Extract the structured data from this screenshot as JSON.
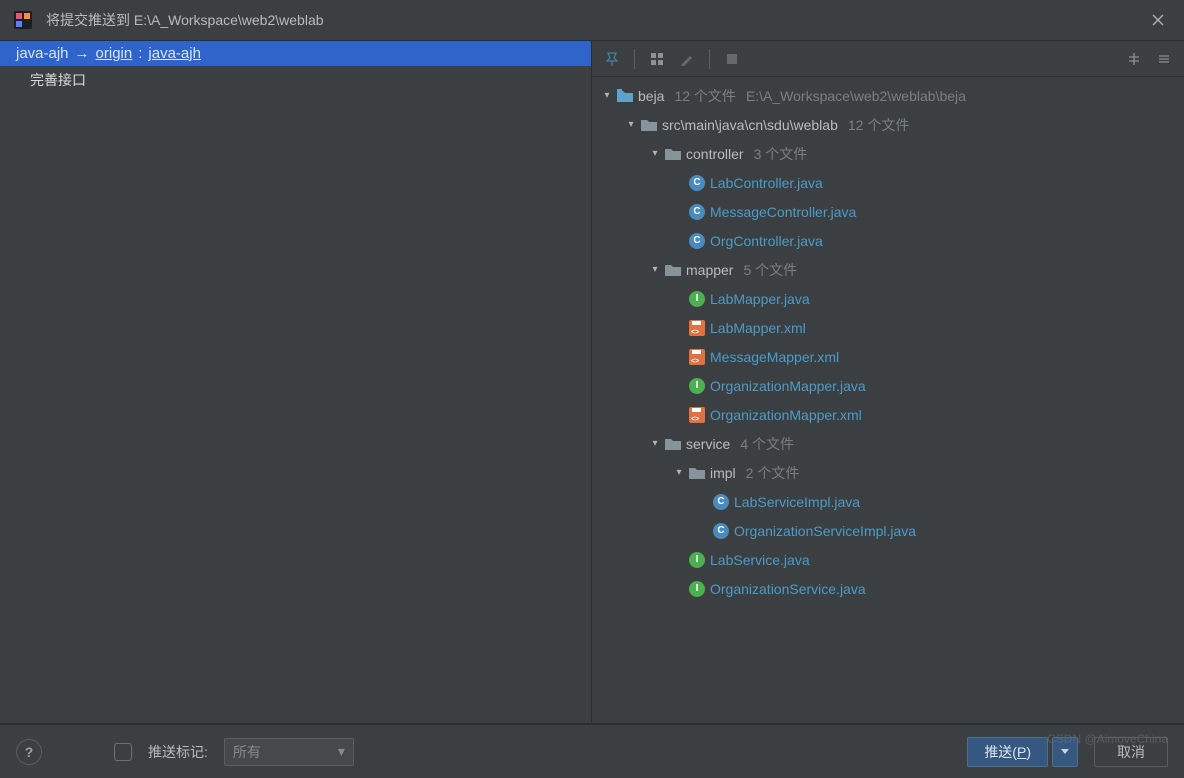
{
  "window": {
    "title": "将提交推送到 E:\\A_Workspace\\web2\\weblab"
  },
  "branch": {
    "local": "java-ajh",
    "arrow": "→",
    "remote": "origin",
    "sep": ":",
    "tracking": "java-ajh"
  },
  "commits": [
    {
      "msg": "完善接口"
    }
  ],
  "tree": {
    "root": {
      "name": "beja",
      "count": "12 个文件",
      "path": "E:\\A_Workspace\\web2\\weblab\\beja"
    },
    "src": {
      "name": "src\\main\\java\\cn\\sdu\\weblab",
      "count": "12 个文件"
    },
    "controller": {
      "name": "controller",
      "count": "3 个文件",
      "files": [
        "LabController.java",
        "MessageController.java",
        "OrgController.java"
      ]
    },
    "mapper": {
      "name": "mapper",
      "count": "5 个文件",
      "files": [
        {
          "n": "LabMapper.java",
          "t": "i"
        },
        {
          "n": "LabMapper.xml",
          "t": "x"
        },
        {
          "n": "MessageMapper.xml",
          "t": "x"
        },
        {
          "n": "OrganizationMapper.java",
          "t": "i"
        },
        {
          "n": "OrganizationMapper.xml",
          "t": "x"
        }
      ]
    },
    "service": {
      "name": "service",
      "count": "4 个文件",
      "impl": {
        "name": "impl",
        "count": "2 个文件",
        "files": [
          "LabServiceImpl.java",
          "OrganizationServiceImpl.java"
        ]
      },
      "files": [
        "LabService.java",
        "OrganizationService.java"
      ]
    }
  },
  "footer": {
    "push_tags_label": "推送标记:",
    "combo_value": "所有",
    "push_btn_prefix": "推送(",
    "push_btn_key": "P",
    "push_btn_suffix": ")",
    "cancel": "取消"
  },
  "watermark": "CSDN @AimoveChina"
}
